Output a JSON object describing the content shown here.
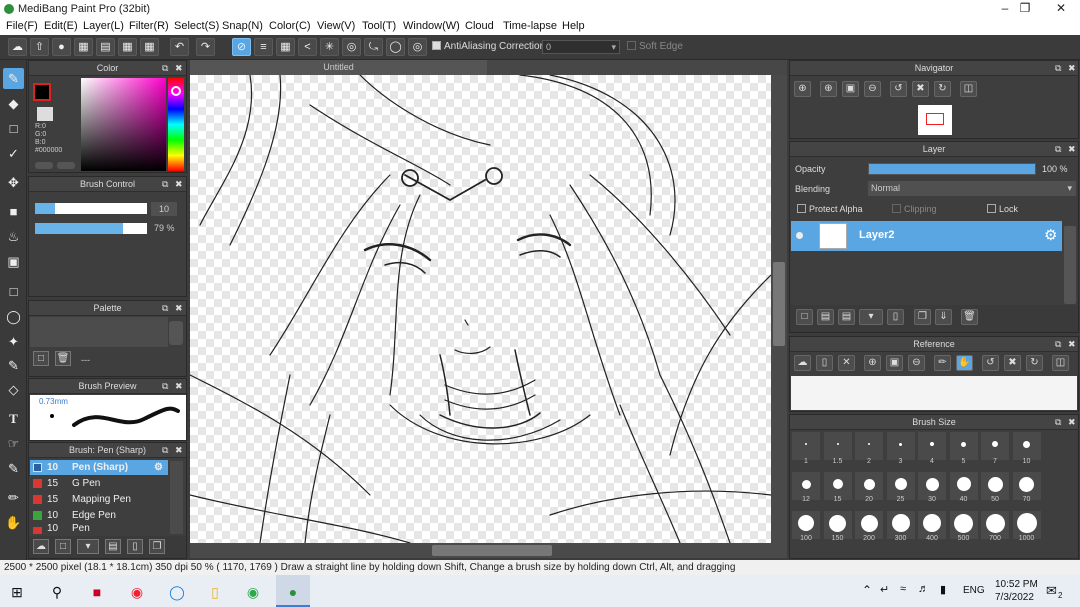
{
  "app": {
    "title": "MediBang Paint Pro (32bit)"
  },
  "menu": [
    "File(F)",
    "Edit(E)",
    "Layer(L)",
    "Filter(R)",
    "Select(S)",
    "Snap(N)",
    "Color(C)",
    "View(V)",
    "Tool(T)",
    "Window(W)",
    "Cloud",
    "Time-lapse",
    "Help"
  ],
  "toolbar": {
    "antialias_label": "AntiAliasing",
    "correction_label": "Correction",
    "correction_value": "0",
    "softedge_label": "Soft Edge"
  },
  "color_panel": {
    "title": "Color",
    "r": "R:0",
    "g": "G:0",
    "b": "B:0",
    "hex": "#000000"
  },
  "brush_control": {
    "title": "Brush Control",
    "size_value": "10",
    "opacity_value": "79 %",
    "opacity_fraction": 0.79
  },
  "palette": {
    "title": "Palette",
    "dash": "---"
  },
  "brush_preview": {
    "title": "Brush Preview",
    "size": "0.73mm"
  },
  "brush_list": {
    "title": "Brush: Pen (Sharp)",
    "items": [
      {
        "size": "10",
        "name": "Pen (Sharp)",
        "color": "#2b5f9e"
      },
      {
        "size": "15",
        "name": "G Pen",
        "color": "#d9372f"
      },
      {
        "size": "15",
        "name": "Mapping Pen",
        "color": "#d9372f"
      },
      {
        "size": "10",
        "name": "Edge Pen",
        "color": "#3aa53a"
      },
      {
        "size": "10",
        "name": "Pen",
        "color": "#d9372f"
      }
    ]
  },
  "canvas": {
    "tab_title": "Untitled"
  },
  "navigator": {
    "title": "Navigator"
  },
  "layer_panel": {
    "title": "Layer",
    "opacity_label": "Opacity",
    "opacity_value": "100 %",
    "opacity_fraction": 1.0,
    "blending_label": "Blending",
    "blending_value": "Normal",
    "protect_alpha": "Protect Alpha",
    "clipping": "Clipping",
    "lock": "Lock",
    "layer_name": "Layer2"
  },
  "reference": {
    "title": "Reference"
  },
  "brush_size": {
    "title": "Brush Size",
    "rows": [
      [
        "1",
        "1.5",
        "2",
        "3",
        "4",
        "5",
        "7",
        "10"
      ],
      [
        "12",
        "15",
        "20",
        "25",
        "30",
        "40",
        "50",
        "70"
      ],
      [
        "100",
        "150",
        "200",
        "300",
        "400",
        "500",
        "700",
        "1000"
      ]
    ]
  },
  "statusbar": {
    "text": "2500 * 2500 pixel   (18.1 * 18.1cm)   350 dpi   50 %   ( 1170, 1769 )   Draw a straight line by holding down Shift, Change a brush size by holding down Ctrl, Alt, and dragging"
  },
  "taskbar": {
    "lang": "ENG",
    "time": "10:52 PM",
    "date": "7/3/2022",
    "notif": "2"
  }
}
